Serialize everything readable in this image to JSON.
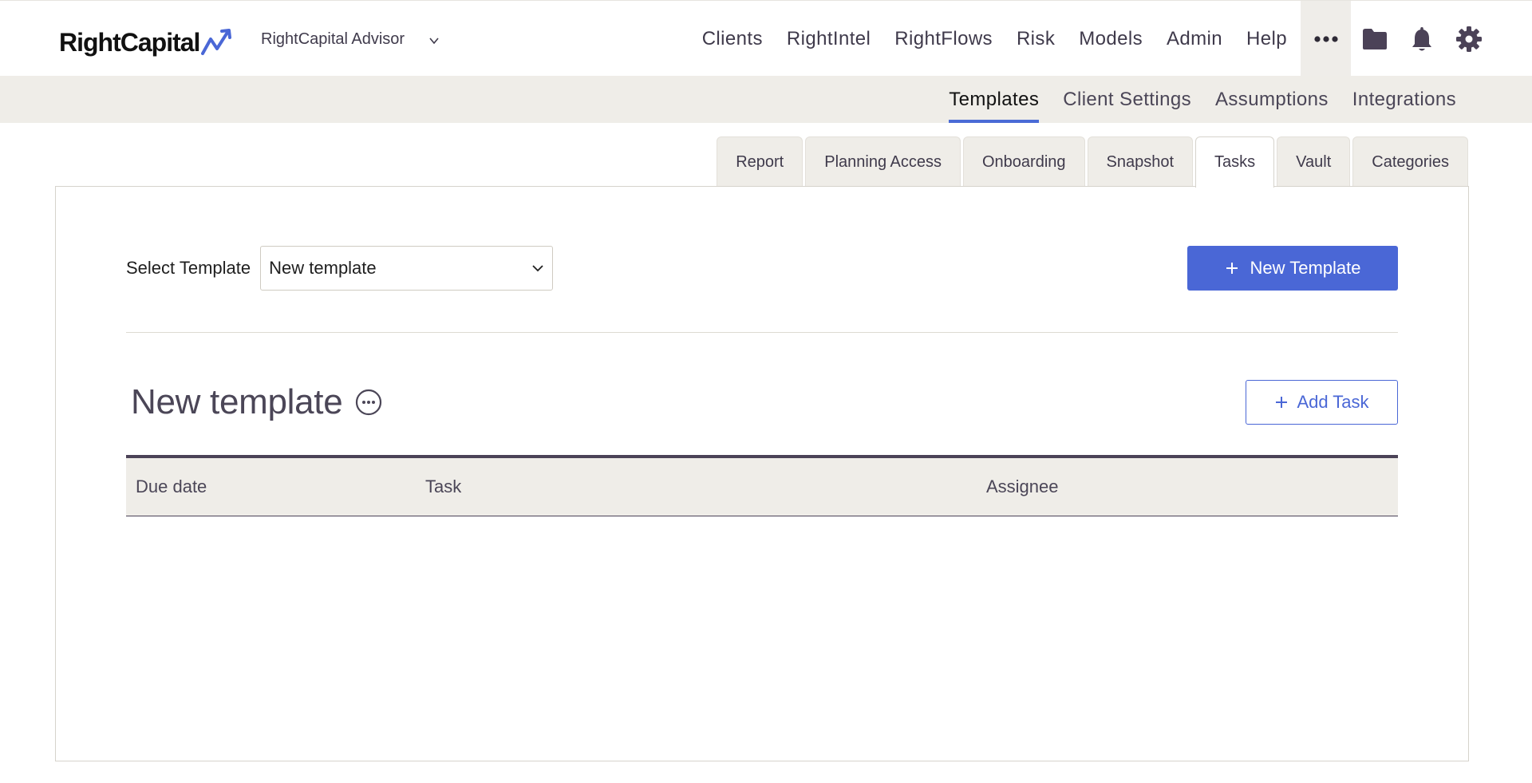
{
  "header": {
    "logo_text": "RightCapital",
    "advisor_name": "RightCapital Advisor",
    "nav": [
      "Clients",
      "RightIntel",
      "RightFlows",
      "Risk",
      "Models",
      "Admin",
      "Help"
    ]
  },
  "subnav": {
    "items": [
      "Templates",
      "Client Settings",
      "Assumptions",
      "Integrations"
    ],
    "active": "Templates"
  },
  "tabs": {
    "items": [
      "Report",
      "Planning Access",
      "Onboarding",
      "Snapshot",
      "Tasks",
      "Vault",
      "Categories"
    ],
    "active": "Tasks"
  },
  "template_selector": {
    "label": "Select Template",
    "selected": "New template"
  },
  "buttons": {
    "new_template": "New Template",
    "add_task": "Add Task"
  },
  "section": {
    "title": "New template"
  },
  "table": {
    "columns": [
      "Due date",
      "Task",
      "Assignee"
    ],
    "rows": []
  },
  "colors": {
    "accent": "#4a67d6",
    "subbar_bg": "#efede8",
    "text_dark": "#4b4657"
  }
}
